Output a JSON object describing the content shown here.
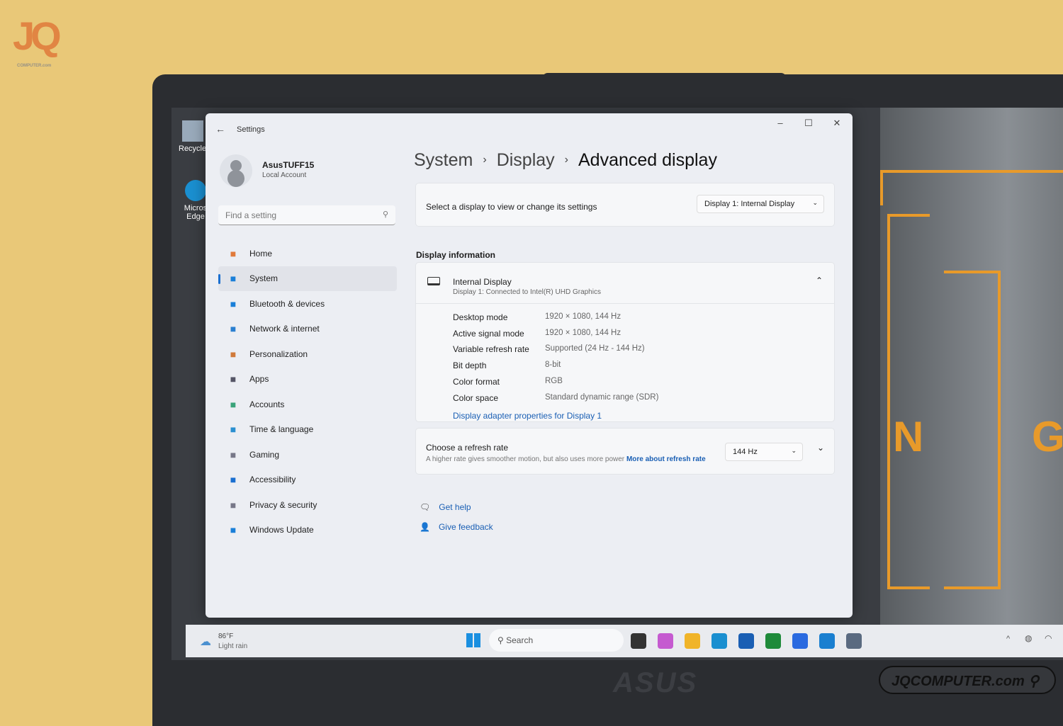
{
  "watermark": {
    "logo_text": "JQ",
    "logo_sub": "COMPUTER.com",
    "badge": "JQCOMPUTER.com",
    "laptop_brand": "ASUS"
  },
  "desktop": {
    "icons": [
      {
        "label": "Recycle",
        "icon": "recycle-bin-icon"
      },
      {
        "label": "Micros Edge",
        "icon": "edge-icon"
      }
    ],
    "wallpaper_letters": [
      "N",
      "G"
    ]
  },
  "window": {
    "title": "Settings",
    "controls": [
      "minimize",
      "maximize",
      "close"
    ]
  },
  "profile": {
    "name": "AsusTUFF15",
    "type": "Local Account"
  },
  "search": {
    "placeholder": "Find a setting"
  },
  "nav": [
    {
      "label": "Home",
      "icon": "home-icon",
      "color": "#e07a3a"
    },
    {
      "label": "System",
      "icon": "system-icon",
      "color": "#1a7fd8",
      "selected": true
    },
    {
      "label": "Bluetooth & devices",
      "icon": "bluetooth-icon",
      "color": "#1a7fd8"
    },
    {
      "label": "Network & internet",
      "icon": "wifi-icon",
      "color": "#2a7fd0"
    },
    {
      "label": "Personalization",
      "icon": "brush-icon",
      "color": "#d07a3a"
    },
    {
      "label": "Apps",
      "icon": "apps-icon",
      "color": "#556"
    },
    {
      "label": "Accounts",
      "icon": "accounts-icon",
      "color": "#3aa37a"
    },
    {
      "label": "Time & language",
      "icon": "globe-icon",
      "color": "#2a8fd0"
    },
    {
      "label": "Gaming",
      "icon": "gamepad-icon",
      "color": "#778"
    },
    {
      "label": "Accessibility",
      "icon": "accessibility-icon",
      "color": "#1a6fd0"
    },
    {
      "label": "Privacy & security",
      "icon": "shield-icon",
      "color": "#778"
    },
    {
      "label": "Windows Update",
      "icon": "update-icon",
      "color": "#1a7fd8"
    }
  ],
  "breadcrumb": [
    "System",
    "Display",
    "Advanced display"
  ],
  "select_display": {
    "label": "Select a display to view or change its settings",
    "value": "Display 1: Internal Display"
  },
  "display_info": {
    "section_title": "Display information",
    "name": "Internal Display",
    "subtitle": "Display 1: Connected to Intel(R) UHD Graphics",
    "rows": [
      {
        "label": "Desktop mode",
        "value": "1920 × 1080, 144 Hz"
      },
      {
        "label": "Active signal mode",
        "value": "1920 × 1080, 144 Hz"
      },
      {
        "label": "Variable refresh rate",
        "value": "Supported (24 Hz - 144 Hz)"
      },
      {
        "label": "Bit depth",
        "value": "8-bit"
      },
      {
        "label": "Color format",
        "value": "RGB"
      },
      {
        "label": "Color space",
        "value": "Standard dynamic range (SDR)"
      }
    ],
    "adapter_link": "Display adapter properties for Display 1"
  },
  "refresh": {
    "title": "Choose a refresh rate",
    "desc": "A higher rate gives smoother motion, but also uses more power",
    "link1": "More about refresh",
    "link2": "rate",
    "value": "144 Hz"
  },
  "help": [
    {
      "label": "Get help",
      "icon": "help-icon"
    },
    {
      "label": "Give feedback",
      "icon": "feedback-icon"
    }
  ],
  "taskbar": {
    "weather_temp": "86°F",
    "weather_desc": "Light rain",
    "search_placeholder": "Search",
    "apps": [
      {
        "icon": "task-view-icon",
        "color": "#333"
      },
      {
        "icon": "copilot-icon",
        "color": "#c55ad0"
      },
      {
        "icon": "file-explorer-icon",
        "color": "#f0b429"
      },
      {
        "icon": "edge-icon",
        "color": "#1a8fd0"
      },
      {
        "icon": "store-icon",
        "color": "#1a5fb4"
      },
      {
        "icon": "xbox-icon",
        "color": "#1e8a3a"
      },
      {
        "icon": "app-icon",
        "color": "#2a6ae0"
      },
      {
        "icon": "outlook-icon",
        "color": "#1a7fd0"
      },
      {
        "icon": "settings-icon",
        "color": "#5a6a80"
      }
    ]
  }
}
